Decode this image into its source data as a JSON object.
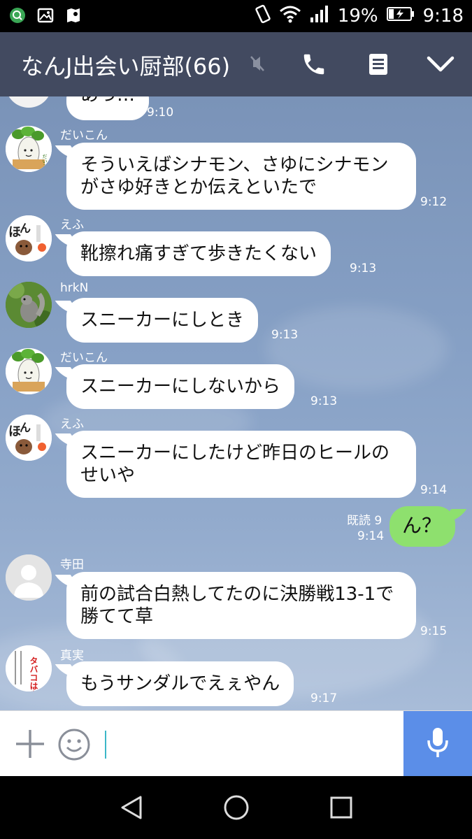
{
  "status_bar": {
    "battery_percent": "19%",
    "time": "9:18",
    "icons": [
      "search-app-icon",
      "gallery-icon",
      "maps-icon",
      "vibrate-icon",
      "wifi-icon",
      "signal-icon",
      "battery-charging-icon"
    ]
  },
  "header": {
    "title": "なんJ出会い厨部(66)",
    "icons": [
      "mute-icon",
      "phone-icon",
      "menu-icon",
      "chevron-down-icon"
    ]
  },
  "messages": [
    {
      "sender": "",
      "text": "あっ…",
      "time": "9:10"
    },
    {
      "sender": "だいこん",
      "text": "そういえばシナモン、さゆにシナモンがさゆ好きとか伝えといたで",
      "time": "9:12"
    },
    {
      "sender": "えふ",
      "text": "靴擦れ痛すぎて歩きたくない",
      "time": "9:13"
    },
    {
      "sender": "hrkN",
      "text": "スニーカーにしとき",
      "time": "9:13"
    },
    {
      "sender": "だいこん",
      "text": "スニーカーにしないから",
      "time": "9:13"
    },
    {
      "sender": "えふ",
      "text": "スニーカーにしたけど昨日のヒールのせいや",
      "time": "9:14"
    },
    {
      "sender": "me",
      "text": "ん？",
      "read": "既読 9",
      "time": "9:14"
    },
    {
      "sender": "寺田",
      "text": "前の試合白熱してたのに決勝戦13-1で勝てて草",
      "time": "9:15"
    },
    {
      "sender": "真実",
      "text": "もうサンダルでえぇやん",
      "time": "9:17"
    }
  ],
  "avatars": {
    "daikon_caption": "だいこん",
    "tobacco_text": "タバコはやめないほうがいい"
  },
  "input": {
    "value": "",
    "icons": [
      "plus-icon",
      "emoji-icon",
      "mic-icon"
    ]
  },
  "nav": {
    "icons": [
      "back-icon",
      "home-icon",
      "recents-icon"
    ]
  }
}
